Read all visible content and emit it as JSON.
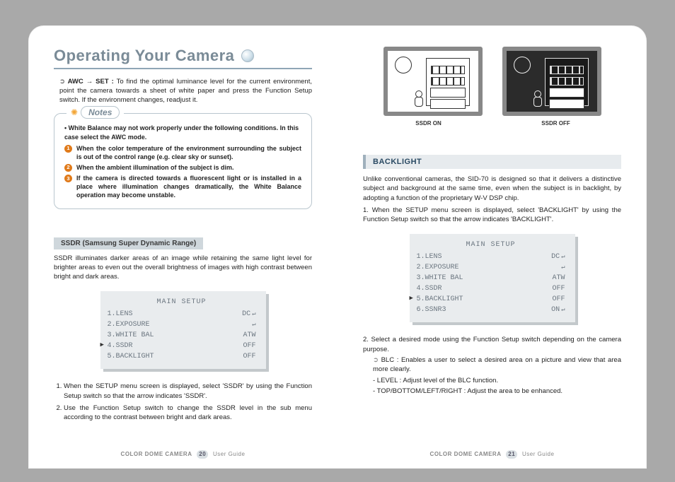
{
  "header": {
    "title": "Operating Your Camera"
  },
  "awc": {
    "label": "AWC → SET :",
    "text": "To find the optimal luminance level for the current environment, point the camera towards a sheet of white paper and press the Function Setup switch. If the environment changes, readjust it."
  },
  "notes": {
    "badge": "Notes",
    "intro": "• White Balance may not work properly under the following conditions. In this case select the AWC mode.",
    "items": [
      "When the color temperature of the environment surrounding the subject is out of the control range (e.g. clear sky or sunset).",
      "When the ambient illumination of the subject is dim.",
      "If the camera is directed towards a fluorescent light or is installed in a place where illumination changes dramatically, the White Balance operation may become unstable."
    ]
  },
  "ssdr": {
    "heading": "SSDR (Samsung Super Dynamic Range)",
    "desc": "SSDR illuminates darker areas of an image while retaining the same light level for brighter areas to even out the overall brightness of images with high contrast between bright and dark areas.",
    "osd": {
      "title": "MAIN SETUP",
      "rows": [
        {
          "l": "1.LENS",
          "r": "DC",
          "ret": true
        },
        {
          "l": "2.EXPOSURE",
          "r": "",
          "ret": true
        },
        {
          "l": "3.WHITE BAL",
          "r": "ATW"
        },
        {
          "l": "4.SSDR",
          "r": "OFF",
          "sel": true
        },
        {
          "l": "5.BACKLIGHT",
          "r": "OFF"
        }
      ]
    },
    "steps": [
      "When the SETUP menu screen is displayed, select 'SSDR' by using the Function Setup switch so that the arrow indicates 'SSDR'.",
      "Use the Function Setup switch to change the SSDR level in the sub menu according to the contrast between bright and dark areas."
    ]
  },
  "illus": {
    "on": "SSDR ON",
    "off": "SSDR OFF"
  },
  "backlight": {
    "heading": "BACKLIGHT",
    "desc": "Unlike conventional cameras, the SID-70 is designed so that it delivers a distinctive subject and background at the same time, even when the subject is in backlight, by adopting a function of the proprietary W-V DSP chip.",
    "step1": "When the SETUP menu screen is displayed, select 'BACKLIGHT' by using the Function Setup switch so that the arrow indicates 'BACKLIGHT'.",
    "osd": {
      "title": "MAIN SETUP",
      "rows": [
        {
          "l": "1.LENS",
          "r": "DC",
          "ret": true
        },
        {
          "l": "2.EXPOSURE",
          "r": "",
          "ret": true
        },
        {
          "l": "3.WHITE BAL",
          "r": "ATW"
        },
        {
          "l": "4.SSDR",
          "r": "OFF"
        },
        {
          "l": "5.BACKLIGHT",
          "r": "OFF",
          "sel": true
        },
        {
          "l": "6.SSNR3",
          "r": "ON",
          "ret": true
        }
      ]
    },
    "step2": "Select a desired mode using the Function Setup switch depending on the camera purpose.",
    "blc": "BLC : Enables a user to select a desired area on a picture and view that area more clearly.",
    "sub1": "- LEVEL : Adjust level of the BLC function.",
    "sub2": "- TOP/BOTTOM/LEFT/RIGHT : Adjust the area to be enhanced."
  },
  "footer": {
    "brand": "COLOR DOME CAMERA",
    "guide": "User Guide",
    "pgL": "20",
    "pgR": "21"
  }
}
